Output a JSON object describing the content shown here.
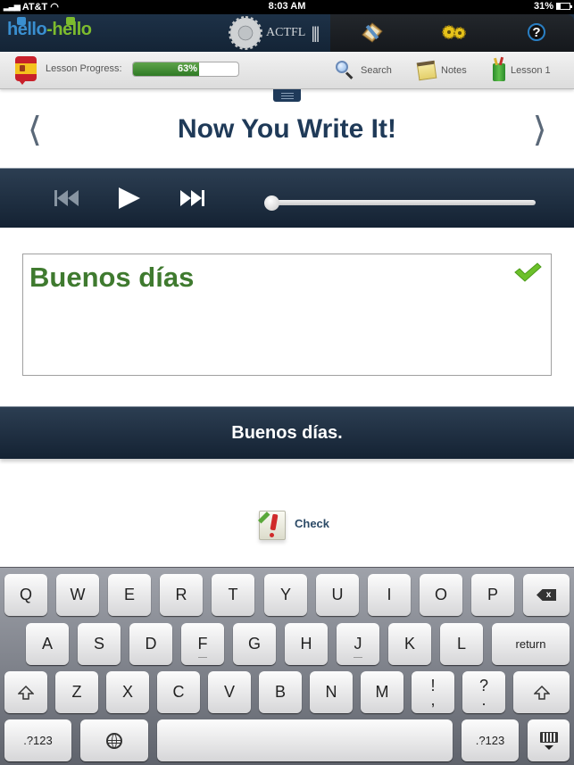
{
  "status_bar": {
    "carrier": "AT&T",
    "time": "8:03 AM",
    "battery": "31%",
    "battery_level": 0.31
  },
  "header": {
    "logo_part1": "hello",
    "logo_dash": "-",
    "logo_part2": "hello",
    "partner_label": "ACTFL",
    "partner_bars": "|||",
    "icons": [
      "book-edit-icon",
      "gears-icon",
      "help-icon"
    ],
    "help_glyph": "?"
  },
  "toolbar": {
    "language_flag": "spain-flag-icon",
    "progress_label": "Lesson Progress:",
    "progress_value": 0.63,
    "progress_text": "63%",
    "search_label": "Search",
    "notes_label": "Notes",
    "lesson_label": "Lesson 1"
  },
  "page": {
    "title": "Now You Write It!",
    "prev_arrow": "❬",
    "next_arrow": "❭"
  },
  "player": {
    "position": 0.0
  },
  "answer": {
    "input_text": "Buenos días",
    "is_correct": true,
    "correct_answer": "Buenos días."
  },
  "check_button": {
    "label": "Check"
  },
  "keyboard": {
    "row1": [
      "Q",
      "W",
      "E",
      "R",
      "T",
      "Y",
      "U",
      "I",
      "O",
      "P"
    ],
    "row2": [
      "A",
      "S",
      "D",
      "F",
      "G",
      "H",
      "J",
      "K",
      "L"
    ],
    "return_label": "return",
    "row3": [
      "Z",
      "X",
      "C",
      "V",
      "B",
      "N",
      "M"
    ],
    "punct1": {
      "top": "!",
      "bottom": ","
    },
    "punct2": {
      "top": "?",
      "bottom": "."
    },
    "numbers_label": ".?123",
    "backspace_glyph": "x"
  }
}
